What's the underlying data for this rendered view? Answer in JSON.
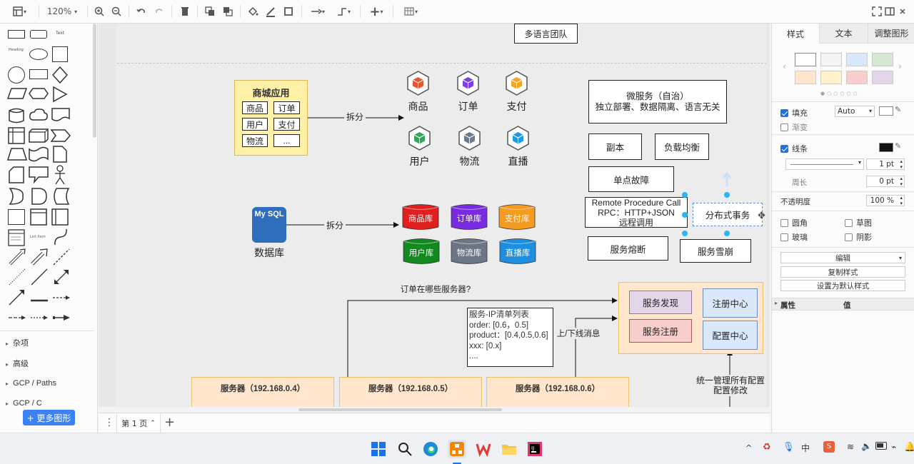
{
  "toolbar": {
    "zoom": "120%"
  },
  "left_panel": {
    "categories": [
      "杂项",
      "高级",
      "GCP / Paths",
      "GCP / C"
    ],
    "more_shapes": "+ 更多图形",
    "tiny_text": "Text",
    "tiny_heading": "Heading"
  },
  "canvas": {
    "team_box": "多语言团队",
    "mall_app": {
      "title": "商城应用",
      "items": [
        "商品",
        "订单",
        "用户",
        "支付",
        "物流",
        "..."
      ]
    },
    "split1": "拆分",
    "split2": "拆分",
    "services": [
      {
        "label": "商品",
        "color": "#e8552e"
      },
      {
        "label": "订单",
        "color": "#7b3fe4"
      },
      {
        "label": "支付",
        "color": "#f5a623"
      },
      {
        "label": "用户",
        "color": "#3aa35b"
      },
      {
        "label": "物流",
        "color": "#6b7b8c"
      },
      {
        "label": "直播",
        "color": "#1e9be0"
      }
    ],
    "mysql": {
      "icon_text": "My SQL",
      "label": "数据库"
    },
    "dbs": [
      {
        "label": "商品库",
        "color": "#e21f1f"
      },
      {
        "label": "订单库",
        "color": "#7a2be2"
      },
      {
        "label": "支付库",
        "color": "#f59b1f"
      },
      {
        "label": "用户库",
        "color": "#128a1f"
      },
      {
        "label": "物流库",
        "color": "#6b7786"
      },
      {
        "label": "直播库",
        "color": "#1e8fe0"
      }
    ],
    "microservice": "微服务（自治）\n独立部署、数据隔离、语言无关",
    "replica": "副本",
    "load_balance": "负载均衡",
    "single_point": "单点故障",
    "rpc": "Remote Procedure Call\nRPC：HTTP+JSON\n远程调用",
    "dist_tx": "分布式事务",
    "circuit": "服务熔断",
    "avalanche": "服务雪崩",
    "order_question": "订单在哪些服务器?",
    "ip_list": "服务-IP清单列表\norder: [0.6，0.5]\nproduct：[0.4,0.5,0.6]\nxxx: [0.x]\n....",
    "online_msg": "上/下线消息",
    "discovery": "服务发现",
    "register": "服务注册",
    "reg_center": "注册中心",
    "config_center": "配置中心",
    "config_note": "统一管理所有配置\n配置修改",
    "servers": [
      "服务器（192.168.0.4）",
      "服务器（192.168.0.5）",
      "服务器（192.168.0.6）"
    ]
  },
  "pagebar": {
    "page": "第 1 页"
  },
  "right_panel": {
    "tabs": [
      "样式",
      "文本",
      "调整图形"
    ],
    "swatches": [
      "#ffffff",
      "#f5f5f5",
      "#dae8fc",
      "#d5e8d4",
      "#ffe6cc",
      "#fff2cc",
      "#f8cecc",
      "#e1d5e7"
    ],
    "fill": "填充",
    "fill_mode": "Auto",
    "gradient": "渐变",
    "line": "线条",
    "line_width": "1 pt",
    "perimeter": "周长",
    "perimeter_val": "0 pt",
    "opacity": "不透明度",
    "opacity_val": "100 %",
    "rounded": "圆角",
    "sketch": "草图",
    "glass": "玻璃",
    "shadow": "阴影",
    "edit": "编辑",
    "copy_style": "复制样式",
    "set_default": "设置为默认样式",
    "prop": "属性",
    "value": "值"
  }
}
